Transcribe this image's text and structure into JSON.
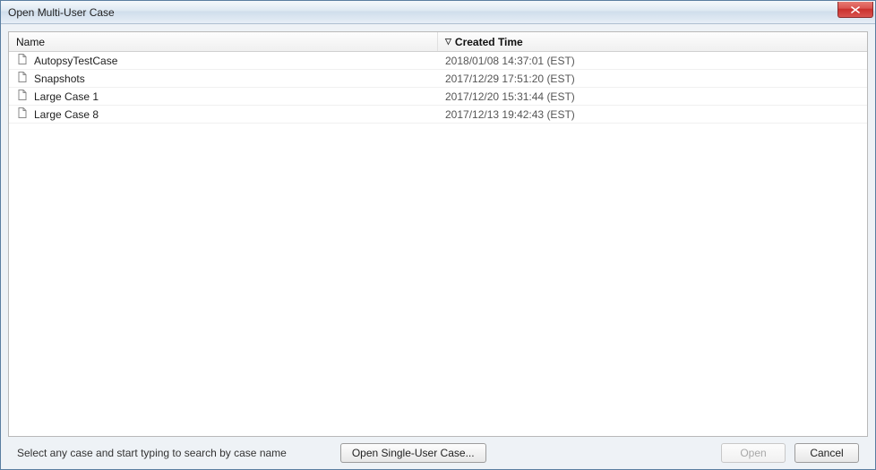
{
  "window": {
    "title": "Open Multi-User Case"
  },
  "table": {
    "columns": {
      "name": "Name",
      "created": "Created Time"
    },
    "sort": {
      "column": "created",
      "direction": "desc",
      "glyph": "▽"
    },
    "rows": [
      {
        "name": "AutopsyTestCase",
        "created": "2018/01/08 14:37:01 (EST)"
      },
      {
        "name": "Snapshots",
        "created": "2017/12/29 17:51:20 (EST)"
      },
      {
        "name": "Large Case 1",
        "created": "2017/12/20 15:31:44 (EST)"
      },
      {
        "name": "Large Case 8",
        "created": "2017/12/13 19:42:43 (EST)"
      }
    ]
  },
  "footer": {
    "hint": "Select any case and start typing to search by case name",
    "open_single_label": "Open Single-User Case...",
    "open_label": "Open",
    "cancel_label": "Cancel",
    "open_enabled": false
  }
}
